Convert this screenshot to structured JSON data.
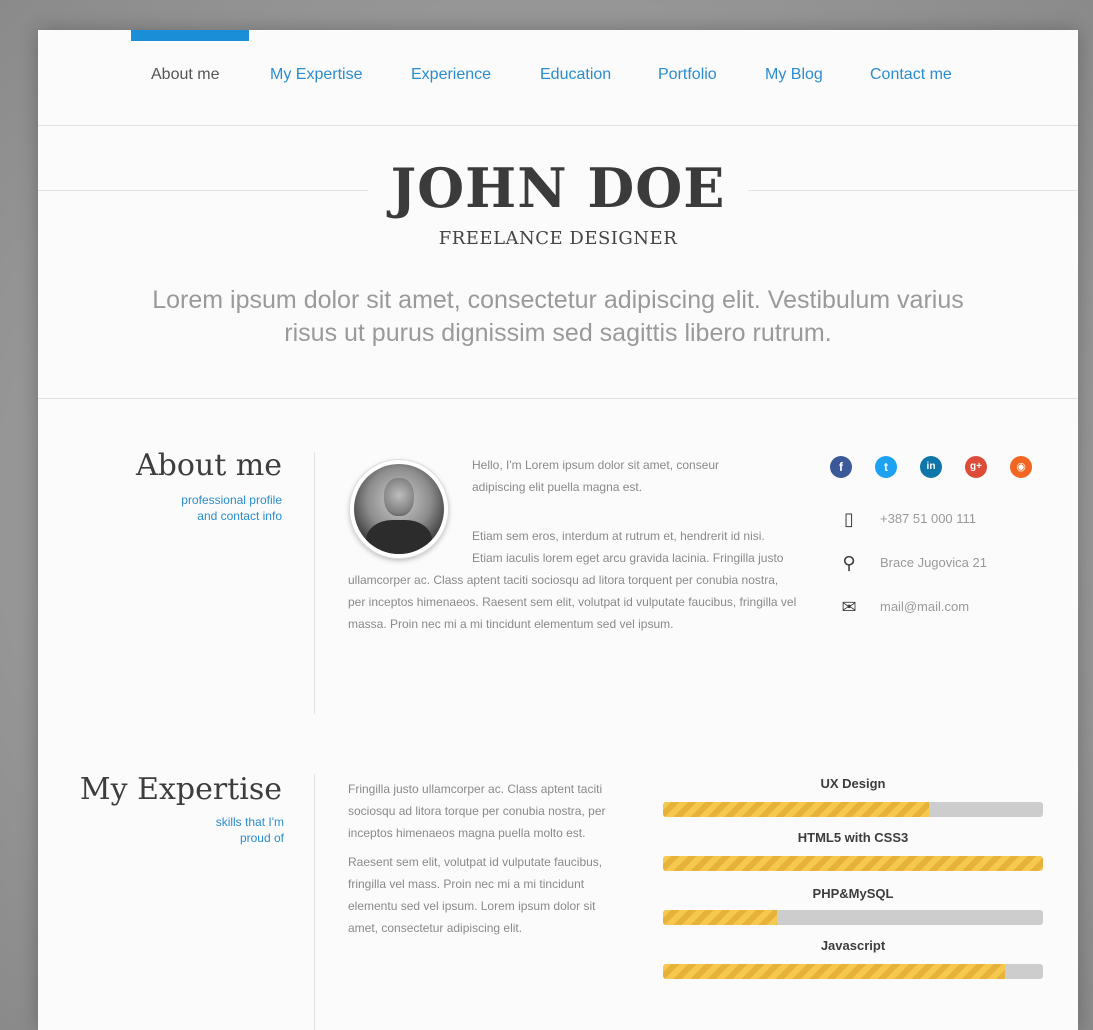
{
  "nav": {
    "items": [
      {
        "label": "About me",
        "active": true
      },
      {
        "label": "My Expertise",
        "active": false
      },
      {
        "label": "Experience",
        "active": false
      },
      {
        "label": "Education",
        "active": false
      },
      {
        "label": "Portfolio",
        "active": false
      },
      {
        "label": "My Blog",
        "active": false
      },
      {
        "label": "Contact me",
        "active": false
      }
    ]
  },
  "hero": {
    "name": "JOHN DOE",
    "title": "FREELANCE DESIGNER",
    "lead": "Lorem ipsum dolor sit amet, consectetur adipiscing elit. Vestibulum varius risus ut purus dignissim sed sagittis libero rutrum."
  },
  "about": {
    "heading": "About me",
    "subheading_line1": "professional profile",
    "subheading_line2": "and contact info",
    "text_para1": "Hello, I'm Lorem ipsum dolor sit amet, conseur adipiscing elit puella magna est.",
    "text_para2": "Etiam sem eros, interdum at rutrum et, hendrerit id nisi. Etiam iaculis lorem eget arcu gravida lacinia. Fringilla justo ullamcorper ac. Class aptent taciti sociosqu ad litora torquent per conubia nostra, per inceptos himenaeos. Raesent sem elit, volutpat id vulputate faucibus, fringilla vel massa. Proin nec mi a mi tincidunt elementum sed vel ipsum.",
    "social": [
      {
        "icon": "facebook-icon",
        "glyph": "f",
        "color": "#3b5998"
      },
      {
        "icon": "twitter-icon",
        "glyph": "t",
        "color": "#1da1f2"
      },
      {
        "icon": "linkedin-icon",
        "glyph": "in",
        "color": "#0e76a8"
      },
      {
        "icon": "googleplus-icon",
        "glyph": "g+",
        "color": "#dd4b39"
      },
      {
        "icon": "rss-icon",
        "glyph": "◉",
        "color": "#f26522"
      }
    ],
    "contacts": {
      "phone": "+387 51 000 111",
      "address": "Brace Jugovica 21",
      "email": "mail@mail.com"
    }
  },
  "expertise": {
    "heading": "My Expertise",
    "subheading_line1": "skills that I'm",
    "subheading_line2": "proud of",
    "text_para1": "Fringilla justo ullamcorper ac. Class aptent taciti sociosqu ad litora torque per conubia nostra, per inceptos himenaeos magna puella molto est.",
    "text_para2": "Raesent sem elit, volutpat id vulputate faucibus, fringilla vel mass. Proin nec mi a mi tincidunt elementu sed vel ipsum. Lorem ipsum dolor sit amet, consectetur adipiscing elit.",
    "skills": [
      {
        "label": "UX Design",
        "level": 0.7
      },
      {
        "label": "HTML5 with CSS3",
        "level": 1.0
      },
      {
        "label": "PHP&MySQL",
        "level": 0.3
      },
      {
        "label": "Javascript",
        "level": 0.9
      }
    ]
  },
  "colors": {
    "accent": "#1a8fd8",
    "skill_fill": "#f6c84e",
    "skill_track": "#cdcdcd"
  }
}
